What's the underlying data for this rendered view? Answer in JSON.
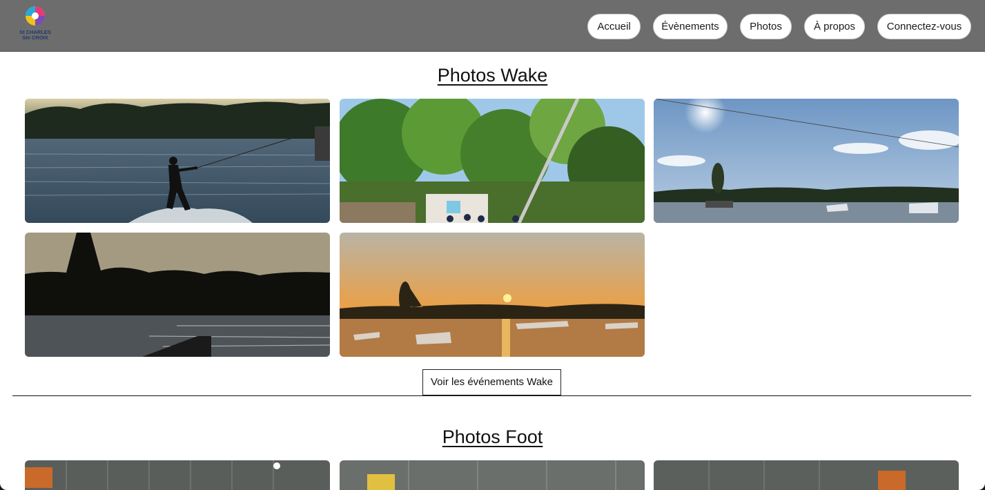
{
  "logo": {
    "line1": "St CHARLES",
    "line2": "Ste CROIX"
  },
  "nav": {
    "items": [
      {
        "label": "Accueil"
      },
      {
        "label": "Évènements"
      },
      {
        "label": "Photos"
      },
      {
        "label": "À propos"
      },
      {
        "label": "Connectez-vous"
      }
    ]
  },
  "sections": {
    "wake": {
      "title": "Photos Wake",
      "button_label": "Voir les événements Wake"
    },
    "foot": {
      "title": "Photos Foot"
    }
  },
  "colors": {
    "navbar": "#6d6d6d",
    "page_background": "#ffffff",
    "button_background": "#ffffff"
  },
  "icons": {
    "logo": "st-charles-logo-icon"
  }
}
